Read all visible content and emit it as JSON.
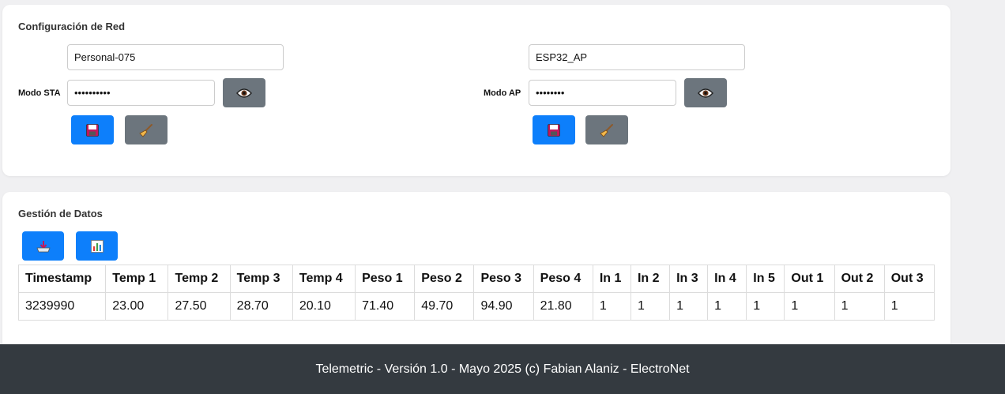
{
  "network": {
    "title": "Configuración de Red",
    "sta": {
      "label": "Modo STA",
      "ssid": "Personal-075",
      "password": "••••••••••"
    },
    "ap": {
      "label": "Modo AP",
      "ssid": "ESP32_AP",
      "password": "••••••••"
    }
  },
  "data_mgmt": {
    "title": "Gestión de Datos",
    "table": {
      "headers": [
        "Timestamp",
        "Temp 1",
        "Temp 2",
        "Temp 3",
        "Temp 4",
        "Peso 1",
        "Peso 2",
        "Peso 3",
        "Peso 4",
        "In 1",
        "In 2",
        "In 3",
        "In 4",
        "In 5",
        "Out 1",
        "Out 2",
        "Out 3"
      ],
      "rows": [
        [
          "3239990",
          "23.00",
          "27.50",
          "28.70",
          "20.10",
          "71.40",
          "49.70",
          "94.90",
          "21.80",
          "1",
          "1",
          "1",
          "1",
          "1",
          "1",
          "1",
          "1"
        ]
      ]
    }
  },
  "footer": {
    "text": "Telemetric - Versión 1.0 - Mayo 2025 (c) Fabian Alaniz - ElectroNet"
  },
  "icons": {
    "save": "floppy-disk-icon",
    "clear": "broom-icon",
    "show_password": "eye-icon",
    "download": "download-tray-icon",
    "chart": "bar-chart-icon"
  },
  "colors": {
    "primary": "#0d7ffb",
    "secondary": "#6c757d",
    "footer_bg": "#343a40"
  }
}
